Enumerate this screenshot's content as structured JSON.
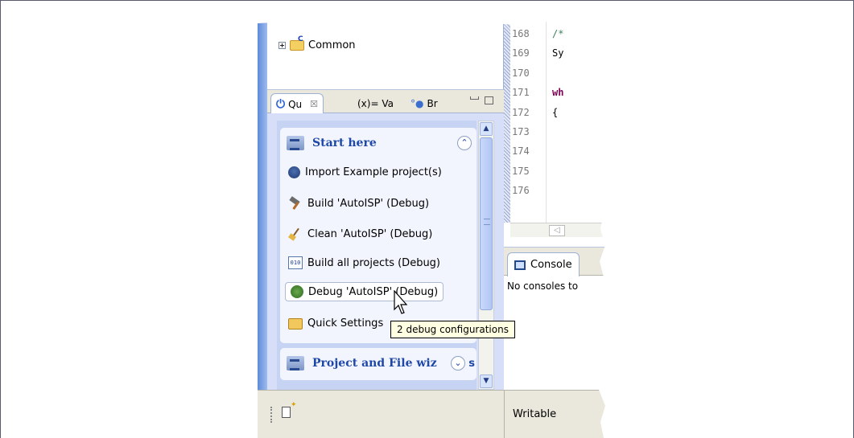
{
  "tree": {
    "common_label": "Common"
  },
  "tabs": [
    {
      "label": "Qu",
      "close": "☒"
    },
    {
      "label": "(x)= Va"
    },
    {
      "label": "Br"
    }
  ],
  "start_section": {
    "title": "Start here",
    "items": [
      {
        "label": "Import Example project(s)",
        "icon": "bulb-icon"
      },
      {
        "label": "Build 'AutoISP' (Debug)",
        "icon": "hammer-icon"
      },
      {
        "label": "Clean 'AutoISP' (Debug)",
        "icon": "broom-icon"
      },
      {
        "label": "Build all projects (Debug)",
        "icon": "binary-icon"
      },
      {
        "label": "Debug 'AutoISP' (Debug)",
        "icon": "bug-icon"
      },
      {
        "label": "Quick Settings",
        "icon": "quick-settings-icon"
      }
    ]
  },
  "project_section": {
    "title": "Project and File wiz",
    "trailing": "s"
  },
  "editor": {
    "line_numbers": [
      "168",
      "169",
      "170",
      "171",
      "172",
      "173",
      "174",
      "175",
      "176"
    ],
    "code_lines": [
      {
        "text": "/*",
        "style": "comment"
      },
      {
        "text": "Sy",
        "style": "normal"
      },
      {
        "text": "",
        "style": "normal"
      },
      {
        "text": "wh",
        "style": "keyword"
      },
      {
        "text": "{",
        "style": "normal"
      },
      {
        "text": "",
        "style": "normal"
      },
      {
        "text": "",
        "style": "normal"
      },
      {
        "text": "",
        "style": "normal"
      },
      {
        "text": "",
        "style": "normal"
      }
    ]
  },
  "console": {
    "tab_label": "Console",
    "message": "No consoles to"
  },
  "status": {
    "writable": "Writable"
  },
  "tooltip": {
    "text": "2 debug configurations"
  },
  "colors": {
    "accent": "#1d47a8",
    "panel": "#c6d3f3",
    "tooltip_bg": "#ffffe1"
  }
}
